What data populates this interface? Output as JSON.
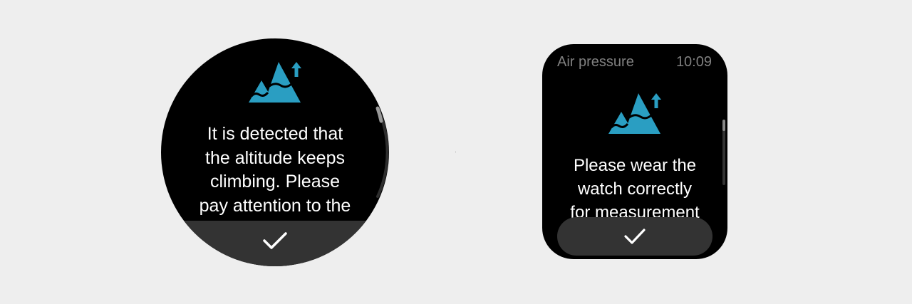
{
  "round_watch": {
    "message_lines": [
      "It is detected that",
      "the altitude keeps",
      "climbing. Please",
      "pay attention to the"
    ],
    "confirm_icon": "check-icon",
    "icon": "mountain-up-arrow-icon"
  },
  "square_watch": {
    "header_title": "Air pressure",
    "time": "10:09",
    "message_lines": [
      "Please wear the",
      "watch correctly",
      "for measurement"
    ],
    "confirm_icon": "check-icon",
    "icon": "mountain-up-arrow-icon"
  },
  "colors": {
    "accent": "#2a9ec2",
    "background": "#eeeeee",
    "button": "#333333",
    "header_text": "#808080"
  }
}
